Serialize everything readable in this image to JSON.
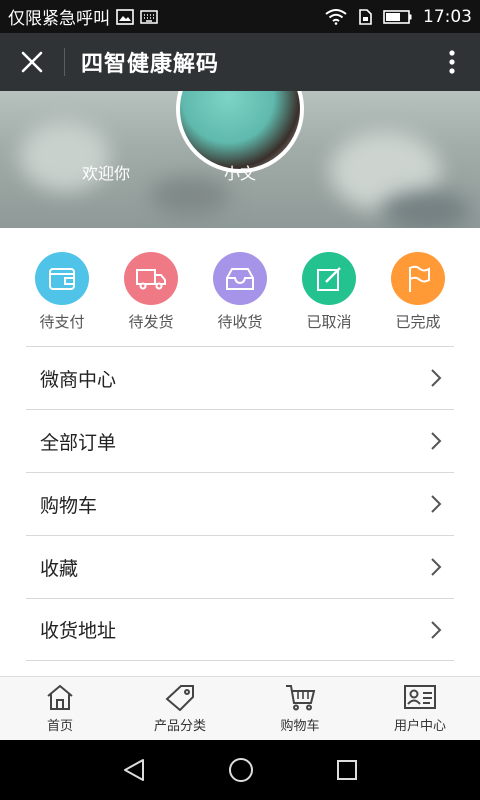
{
  "status_bar": {
    "carrier_text": "仅限紧急呼叫",
    "time": "17:03"
  },
  "title_bar": {
    "title": "四智健康解码"
  },
  "banner": {
    "welcome": "欢迎你",
    "username": "小文"
  },
  "orders": [
    {
      "label": "待支付",
      "icon": "wallet-icon",
      "color": "#4fc3e8"
    },
    {
      "label": "待发货",
      "icon": "truck-icon",
      "color": "#ef7a86"
    },
    {
      "label": "待收货",
      "icon": "inbox-icon",
      "color": "#a694e8"
    },
    {
      "label": "已取消",
      "icon": "edit-icon",
      "color": "#24c28f"
    },
    {
      "label": "已完成",
      "icon": "flag-icon",
      "color": "#ff9a36"
    }
  ],
  "menu": [
    {
      "label": "微商中心"
    },
    {
      "label": "全部订单"
    },
    {
      "label": "购物车"
    },
    {
      "label": "收藏"
    },
    {
      "label": "收货地址"
    }
  ],
  "tabs": [
    {
      "label": "首页",
      "icon": "home-icon"
    },
    {
      "label": "产品分类",
      "icon": "tag-icon"
    },
    {
      "label": "购物车",
      "icon": "cart-icon"
    },
    {
      "label": "用户中心",
      "icon": "user-card-icon"
    }
  ]
}
